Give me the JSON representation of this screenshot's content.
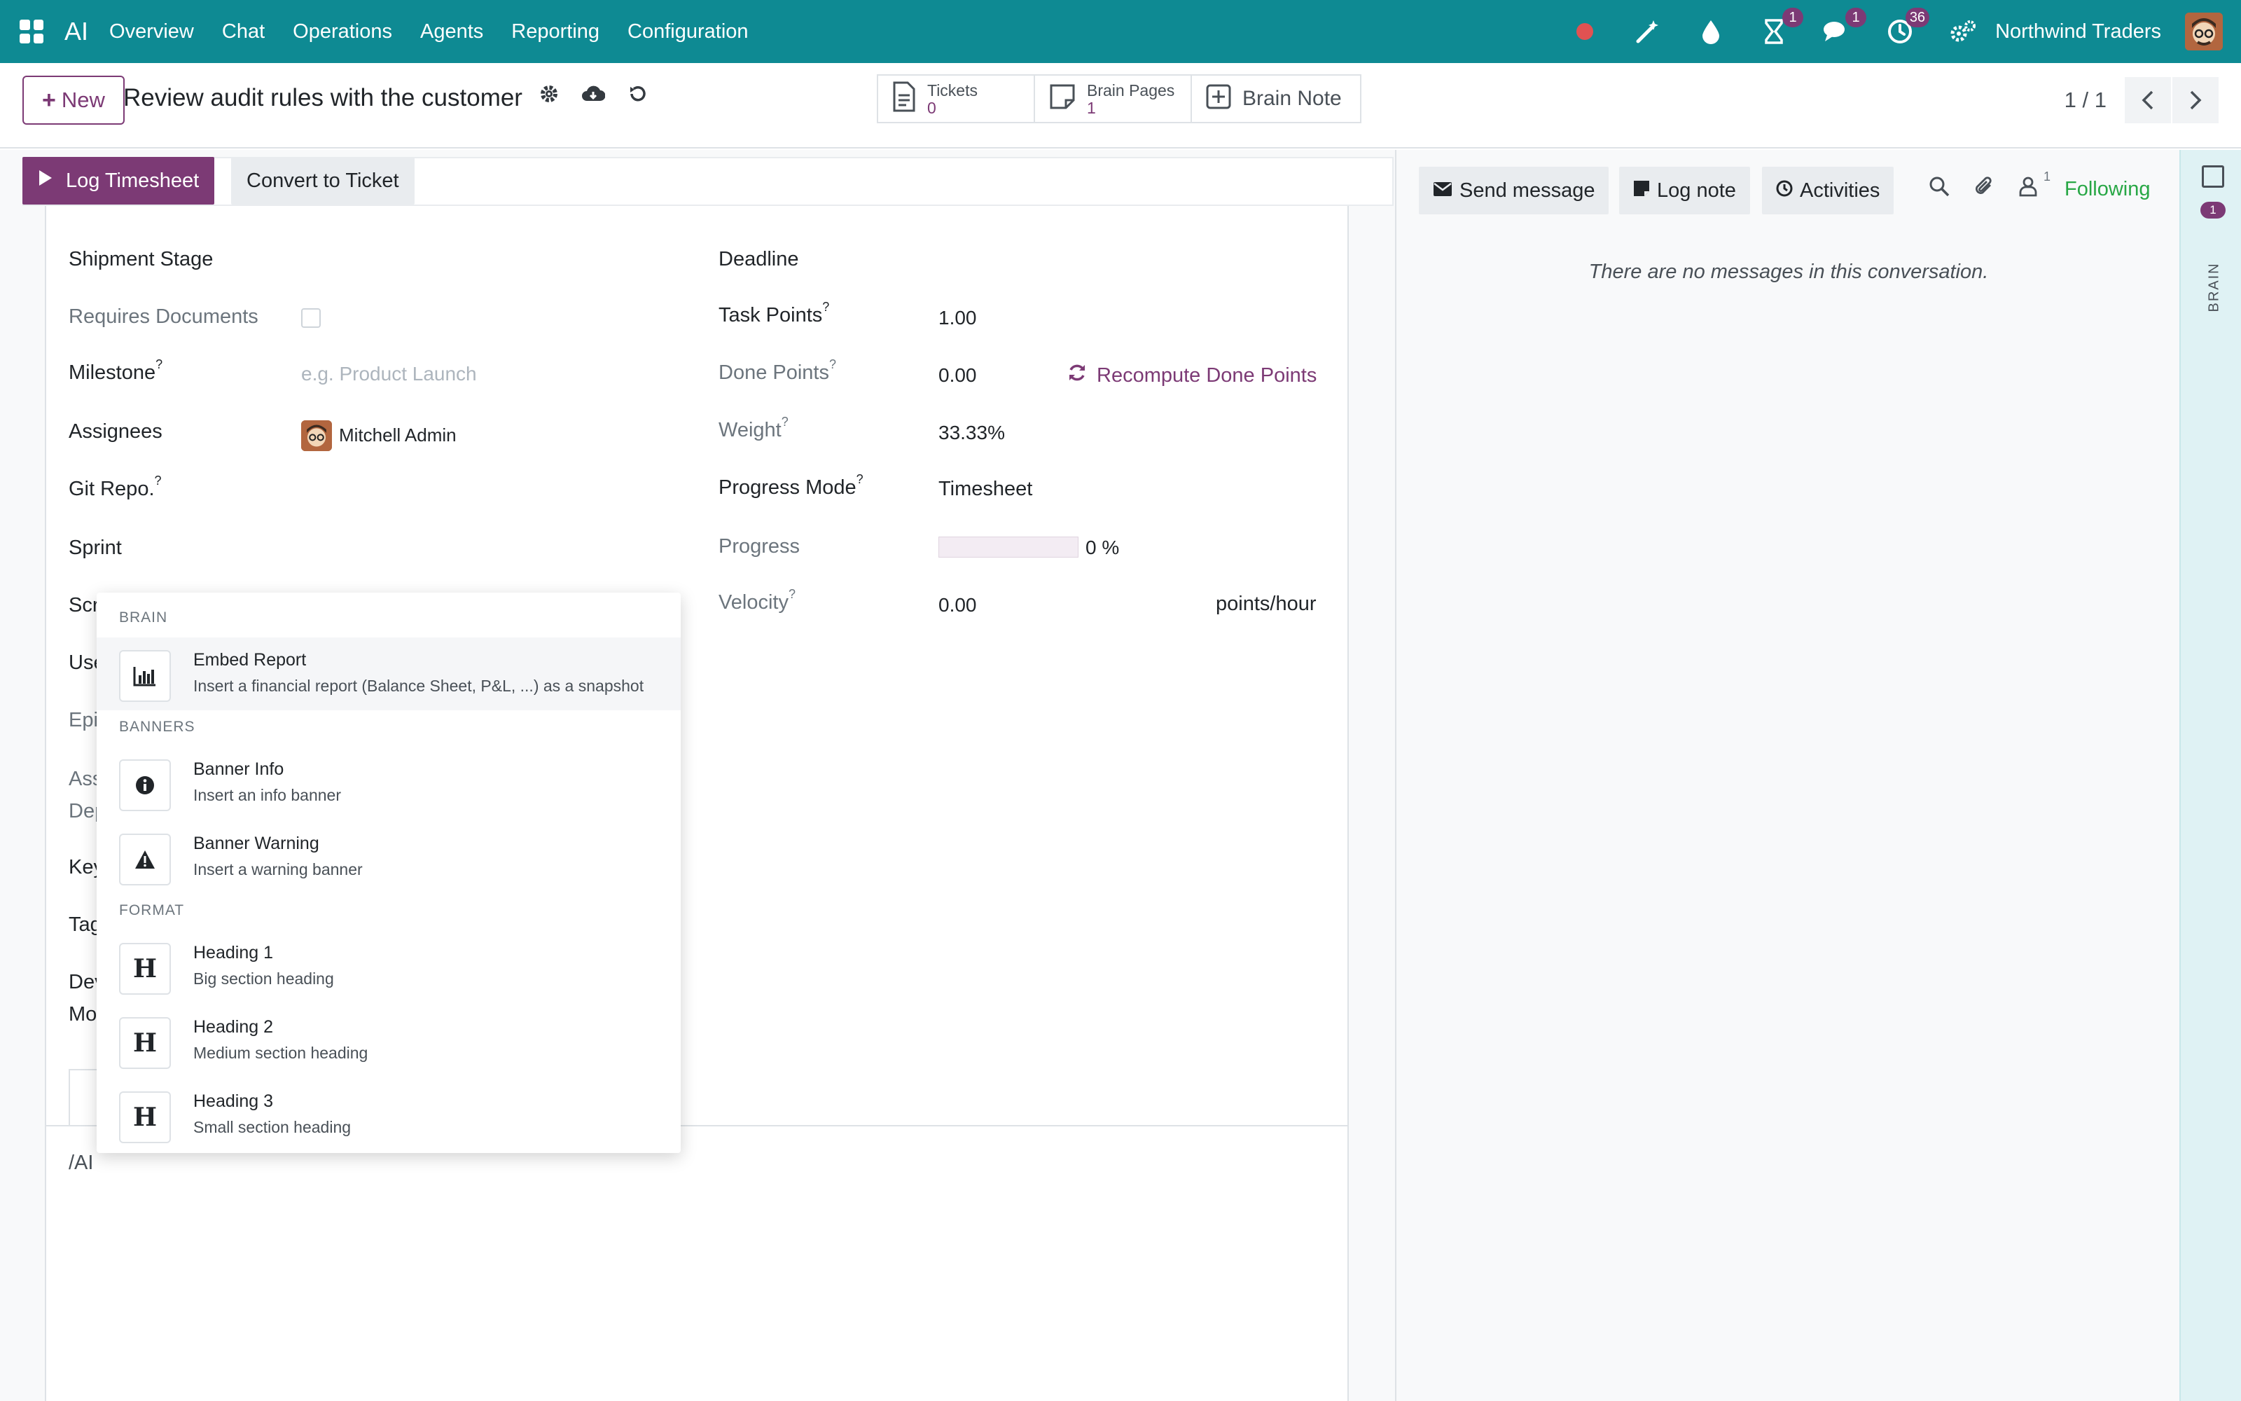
{
  "navbar": {
    "brand": "AI",
    "menus": [
      "Overview",
      "Chat",
      "Operations",
      "Agents",
      "Reporting",
      "Configuration"
    ],
    "badges": {
      "activities": "1",
      "messages": "1",
      "clock": "36"
    },
    "company": "Northwind Traders"
  },
  "control": {
    "new_label": "New",
    "record_title": "Review audit rules with the customer",
    "smart": {
      "tickets_label": "Tickets",
      "tickets_count": "0",
      "pages_label": "Brain Pages",
      "pages_count": "1",
      "note_label": "Brain Note"
    },
    "pager": "1 / 1"
  },
  "statusbar": {
    "log_timesheet": "Log Timesheet",
    "convert_ticket": "Convert to Ticket"
  },
  "form": {
    "left": {
      "shipment_stage": "Shipment Stage",
      "requires_documents": "Requires Documents",
      "milestone": "Milestone",
      "milestone_placeholder": "e.g. Product Launch",
      "assignees": "Assignees",
      "assignee_name": "Mitchell Admin",
      "git_repo": "Git Repo.",
      "sprint": "Sprint",
      "partial": [
        "Scr",
        "Use",
        "Epi",
        "Ass",
        "Dep",
        "Key",
        "Tag",
        "Dev",
        "Mo"
      ]
    },
    "right": {
      "deadline": "Deadline",
      "task_points": "Task Points",
      "task_points_value": "1.00",
      "done_points": "Done Points",
      "done_points_value": "0.00",
      "recompute": "Recompute Done Points",
      "weight": "Weight",
      "weight_value": "33.33%",
      "progress_mode": "Progress Mode",
      "progress_mode_value": "Timesheet",
      "progress": "Progress",
      "progress_value": "0 %",
      "progress_fraction": 0,
      "velocity": "Velocity",
      "velocity_value": "0.00",
      "velocity_unit": "points/hour"
    },
    "question_mark": "?",
    "editor_text": "/AI"
  },
  "powerbox": {
    "categories": {
      "brain": "BRAIN",
      "banners": "BANNERS",
      "format": "FORMAT"
    },
    "items": [
      {
        "title": "Embed Report",
        "desc": "Insert a financial report (Balance Sheet, P&L, ...) as a snapshot",
        "icon": "bar-chart-icon"
      },
      {
        "title": "Banner Info",
        "desc": "Insert an info banner",
        "icon": "info-icon"
      },
      {
        "title": "Banner Warning",
        "desc": "Insert a warning banner",
        "icon": "warning-icon"
      },
      {
        "title": "Heading 1",
        "desc": "Big section heading",
        "icon": "heading-icon",
        "glyph": "H"
      },
      {
        "title": "Heading 2",
        "desc": "Medium section heading",
        "icon": "heading-icon",
        "glyph": "H"
      },
      {
        "title": "Heading 3",
        "desc": "Small section heading",
        "icon": "heading-icon",
        "glyph": "H"
      }
    ]
  },
  "chatter": {
    "send_message": "Send message",
    "log_note": "Log note",
    "activities": "Activities",
    "followers_count": "1",
    "following": "Following",
    "empty": "There are no messages in this conversation."
  },
  "sidepanel": {
    "badge": "1",
    "label": "BRAIN"
  },
  "colors": {
    "navbar": "#0e8a93",
    "primary": "#7c3a75",
    "following": "#28a745"
  }
}
